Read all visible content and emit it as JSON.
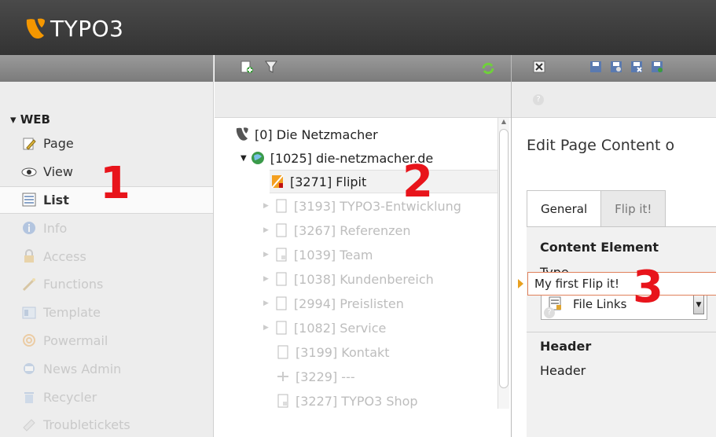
{
  "app": {
    "logo_text": "TYPO3",
    "brand_color": "#f49700"
  },
  "module_menu": {
    "group": "▾ WEB",
    "items": [
      {
        "label": "Page",
        "icon": "pencil-page-icon",
        "state": "normal"
      },
      {
        "label": "View",
        "icon": "eye-icon",
        "state": "normal"
      },
      {
        "label": "List",
        "icon": "list-icon",
        "state": "active"
      },
      {
        "label": "Info",
        "icon": "info-icon",
        "state": "faded"
      },
      {
        "label": "Access",
        "icon": "lock-icon",
        "state": "faded"
      },
      {
        "label": "Functions",
        "icon": "wand-icon",
        "state": "faded"
      },
      {
        "label": "Template",
        "icon": "template-icon",
        "state": "faded"
      },
      {
        "label": "Powermail",
        "icon": "at-icon",
        "state": "faded"
      },
      {
        "label": "News Admin",
        "icon": "news-icon",
        "state": "faded"
      },
      {
        "label": "Recycler",
        "icon": "trash-icon",
        "state": "faded"
      },
      {
        "label": "Troubletickets",
        "icon": "ticket-icon",
        "state": "faded"
      }
    ]
  },
  "page_tree": {
    "nodes": [
      {
        "label": "[0] Die Netzmacher",
        "icon": "typo3-root-icon",
        "state": "normal"
      },
      {
        "label": "[1025] die-netzmacher.de",
        "icon": "globe-icon",
        "state": "normal"
      },
      {
        "label": "[3271] Flipit",
        "icon": "flipit-page-icon",
        "state": "selected"
      },
      {
        "label": "[3193] TYPO3-Entwicklung",
        "icon": "page-icon",
        "state": "faded"
      },
      {
        "label": "[3267] Referenzen",
        "icon": "page-icon",
        "state": "faded"
      },
      {
        "label": "[1039] Team",
        "icon": "page-shortcut-icon",
        "state": "faded"
      },
      {
        "label": "[1038] Kundenbereich",
        "icon": "page-icon",
        "state": "faded"
      },
      {
        "label": "[2994] Preislisten",
        "icon": "page-icon",
        "state": "faded"
      },
      {
        "label": "[1082] Service",
        "icon": "page-icon",
        "state": "faded"
      },
      {
        "label": "[3199] Kontakt",
        "icon": "page-icon",
        "state": "faded"
      },
      {
        "label": "[3229] ---",
        "icon": "spacer-icon",
        "state": "faded"
      },
      {
        "label": "[3227] TYPO3 Shop",
        "icon": "page-shortcut-icon",
        "state": "faded"
      }
    ]
  },
  "edit": {
    "title": "Edit Page Content o",
    "tabs": [
      "General",
      "Flip it!"
    ],
    "content_element_heading": "Content Element",
    "type_label": "Type",
    "type_value": "File Links",
    "header_heading": "Header",
    "header_label": "Header",
    "header_value": "My first Flip it!"
  },
  "annotations": [
    "1",
    "2",
    "3"
  ]
}
